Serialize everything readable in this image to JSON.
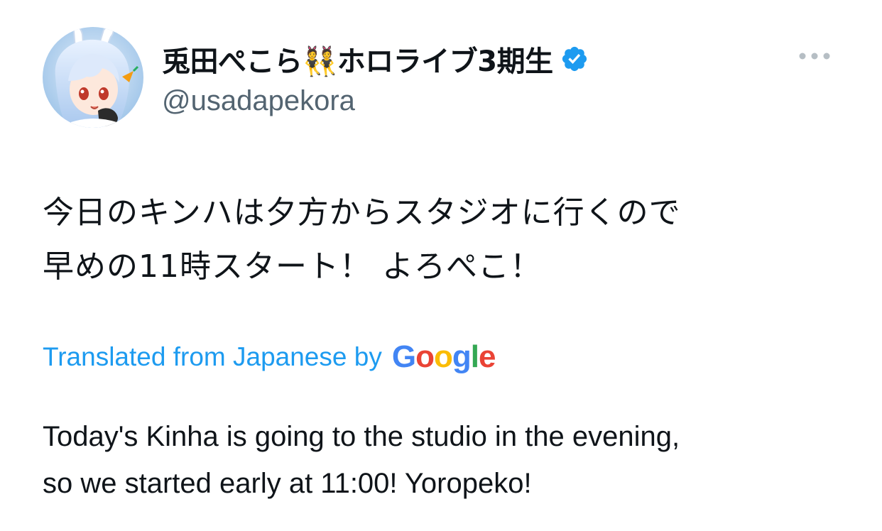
{
  "author": {
    "display_name": "兎田ぺこら👯ホロライブ3期生",
    "handle": "@usadapekora",
    "verified_icon": "verified-badge-icon",
    "verified_color": "#1d9bf0",
    "avatar_icon": "avatar-icon"
  },
  "menu": {
    "icon": "more-horizontal-icon"
  },
  "tweet": {
    "text_line1": "今日のキンハは夕方からスタジオに行くので",
    "text_line2": "早めの11時スタート！ よろぺこ！"
  },
  "translation": {
    "label": "Translated from Japanese by",
    "provider": {
      "letters": [
        "G",
        "o",
        "o",
        "g",
        "l",
        "e"
      ],
      "colors": [
        "#4285F4",
        "#EA4335",
        "#FBBC05",
        "#4285F4",
        "#34A853",
        "#EA4335"
      ]
    },
    "text_line1": "Today's Kinha is going to the studio in the evening,",
    "text_line2": "so we started early at 11:00! Yoropeko!"
  },
  "colors": {
    "text_primary": "#0f1419",
    "text_secondary": "#536471",
    "link": "#1d9bf0"
  }
}
